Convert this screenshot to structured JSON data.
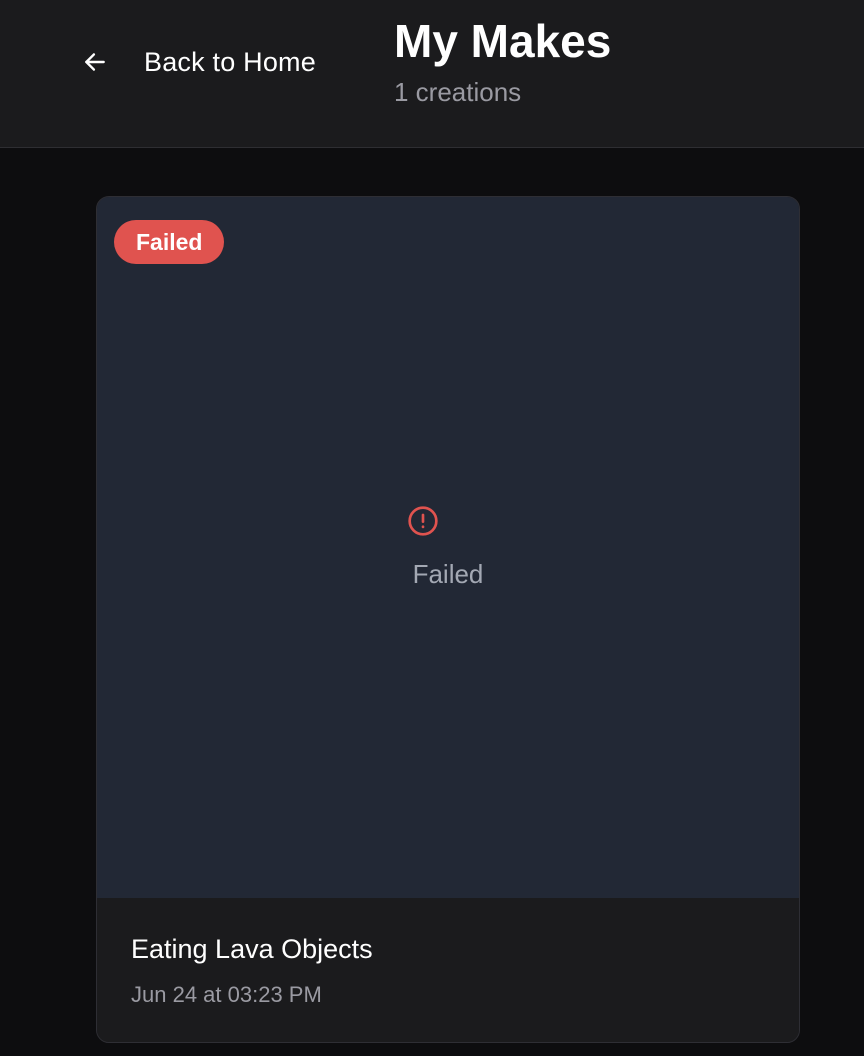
{
  "header": {
    "back_label": "Back to Home",
    "back_icon": "arrow-left-icon",
    "title": "My Makes",
    "subtitle": "1 creations"
  },
  "creations": [
    {
      "status": "Failed",
      "preview_icon": "alert-circle-icon",
      "preview_label": "Failed",
      "title": "Eating Lava Objects",
      "date": "Jun 24 at 03:23 PM"
    }
  ],
  "colors": {
    "background": "#0d0d0f",
    "header": "#1b1b1d",
    "preview": "#222835",
    "failed": "#e0534f"
  }
}
